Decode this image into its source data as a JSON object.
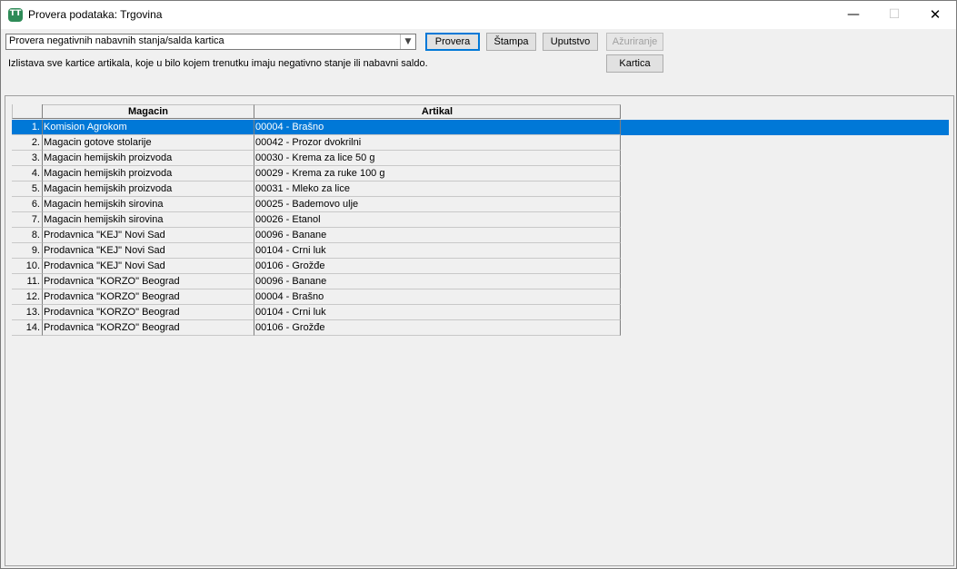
{
  "window": {
    "title": "Provera podataka: Trgovina",
    "min_glyph": "—",
    "max_glyph": "☐",
    "close_glyph": "✕"
  },
  "toolbar": {
    "check_type": "Provera negativnih nabavnih stanja/salda kartica",
    "dropdown_glyph": "▼",
    "provera_label": "Provera",
    "stampa_label": "Štampa",
    "uputstvo_label": "Uputstvo",
    "azuriranje_label": "Ažuriranje",
    "kartica_label": "Kartica"
  },
  "description": "Izlistava sve kartice artikala, koje u bilo kojem trenutku imaju negativno stanje ili nabavni saldo.",
  "grid": {
    "columns": [
      "Magacin",
      "Artikal"
    ],
    "selected_row": 0,
    "rows": [
      {
        "num": "1.",
        "magacin": "Komision Agrokom",
        "artikal": "00004 - Brašno"
      },
      {
        "num": "2.",
        "magacin": "Magacin gotove stolarije",
        "artikal": "00042 - Prozor dvokrilni"
      },
      {
        "num": "3.",
        "magacin": "Magacin hemijskih proizvoda",
        "artikal": "00030 - Krema za lice 50 g"
      },
      {
        "num": "4.",
        "magacin": "Magacin hemijskih proizvoda",
        "artikal": "00029 - Krema za ruke 100 g"
      },
      {
        "num": "5.",
        "magacin": "Magacin hemijskih proizvoda",
        "artikal": "00031 - Mleko za lice"
      },
      {
        "num": "6.",
        "magacin": "Magacin hemijskih sirovina",
        "artikal": "00025 - Bademovo ulje"
      },
      {
        "num": "7.",
        "magacin": "Magacin hemijskih sirovina",
        "artikal": "00026 - Etanol"
      },
      {
        "num": "8.",
        "magacin": "Prodavnica \"KEJ\" Novi Sad",
        "artikal": "00096 - Banane"
      },
      {
        "num": "9.",
        "magacin": "Prodavnica \"KEJ\" Novi Sad",
        "artikal": "00104 - Crni luk"
      },
      {
        "num": "10.",
        "magacin": "Prodavnica \"KEJ\" Novi Sad",
        "artikal": "00106 - Grožđe"
      },
      {
        "num": "11.",
        "magacin": "Prodavnica \"KORZO\" Beograd",
        "artikal": "00096 - Banane"
      },
      {
        "num": "12.",
        "magacin": "Prodavnica \"KORZO\" Beograd",
        "artikal": "00004 - Brašno"
      },
      {
        "num": "13.",
        "magacin": "Prodavnica \"KORZO\" Beograd",
        "artikal": "00104 - Crni luk"
      },
      {
        "num": "14.",
        "magacin": "Prodavnica \"KORZO\" Beograd",
        "artikal": "00106 - Grožđe"
      }
    ]
  },
  "colors": {
    "selection": "#0078d7",
    "focus_border": "#0078d7",
    "window_bg": "#f0f0f0"
  }
}
